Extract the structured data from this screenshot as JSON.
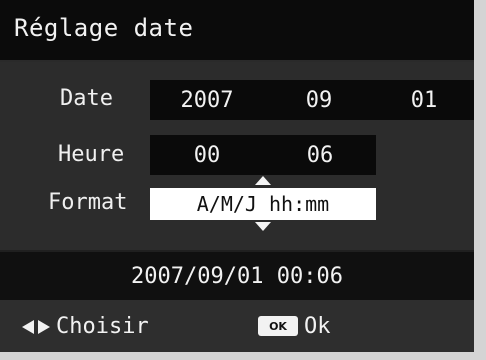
{
  "title": "Réglage date",
  "rows": {
    "date": {
      "label": "Date",
      "values": [
        "2007",
        "09",
        "01"
      ]
    },
    "time": {
      "label": "Heure",
      "values": [
        "00",
        "06"
      ]
    },
    "format": {
      "label": "Format",
      "value": "A/M/J hh:mm"
    }
  },
  "readout": "2007/09/01 00:06",
  "footer": {
    "choose_label": "Choisir",
    "ok_badge": "OK",
    "ok_label": "Ok",
    "icons": {
      "choose": "left-right-arrows-icon",
      "ok": "ok-button-icon"
    }
  },
  "colors": {
    "background": "#050505",
    "panel": "#2c2c2c",
    "highlight": "#ffffff",
    "text": "#f2f2f2"
  }
}
